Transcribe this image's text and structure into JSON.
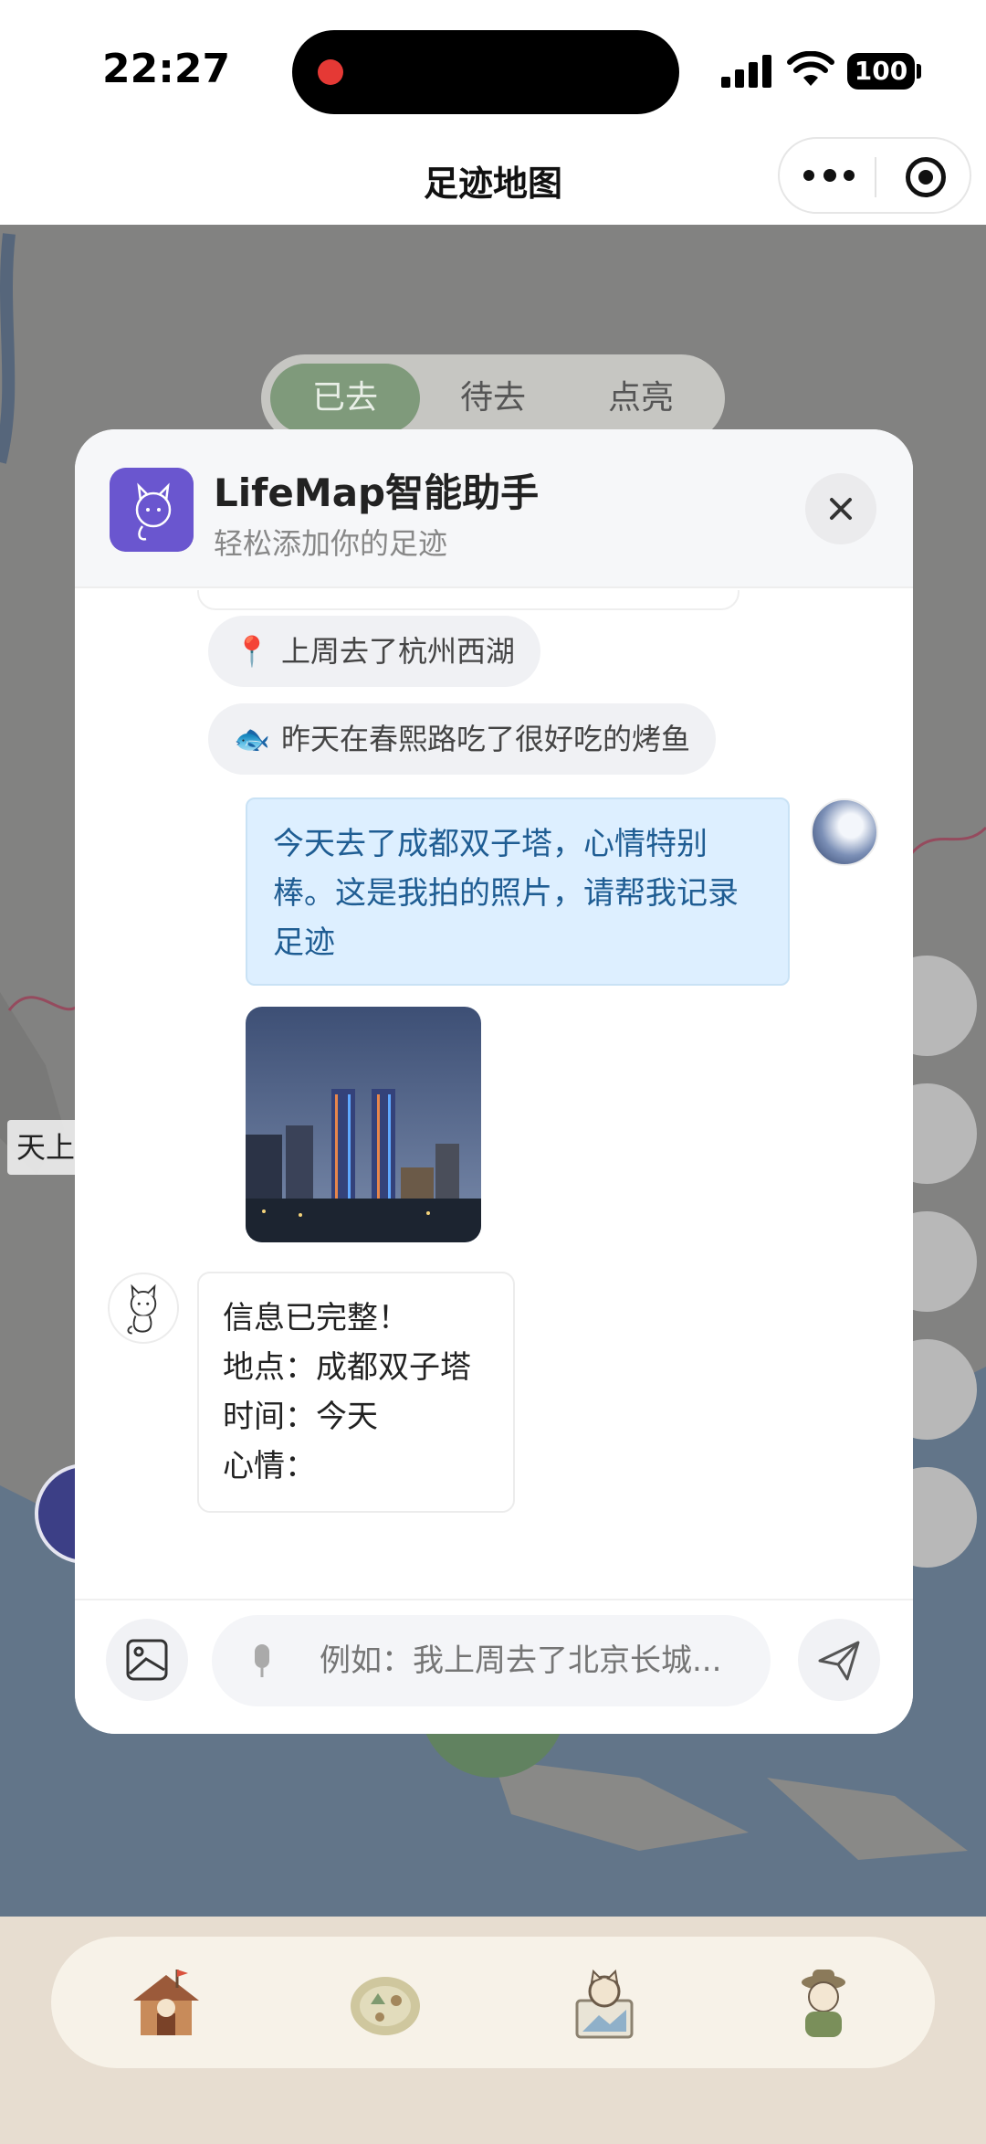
{
  "status_bar": {
    "time": "22:27",
    "battery": "100"
  },
  "nav": {
    "title": "足迹地图"
  },
  "map": {
    "segments": [
      "已去",
      "待去",
      "点亮"
    ],
    "active_segment": "已去",
    "place_label": "天上"
  },
  "dialog": {
    "title": "LifeMap智能助手",
    "subtitle": "轻松添加你的足迹",
    "suggestions": [
      {
        "emoji": "📍",
        "text": "上周去了杭州西湖"
      },
      {
        "emoji": "🐟",
        "text": "昨天在春熙路吃了很好吃的烤鱼"
      }
    ],
    "user_message": "今天去了成都双子塔，心情特别棒。这是我拍的照片，请帮我记录足迹",
    "bot_reply_lines": [
      "信息已完整！",
      "地点：成都双子塔",
      "时间：今天",
      "心情："
    ],
    "input_placeholder": "例如：我上周去了北京长城..."
  },
  "tabs": [
    "home-icon",
    "map-icon",
    "photo-icon",
    "profile-icon"
  ],
  "colors": {
    "accent_purple": "#6f5dd6",
    "user_bubble": "#ddefff",
    "active_segment": "#7f9a7b"
  }
}
